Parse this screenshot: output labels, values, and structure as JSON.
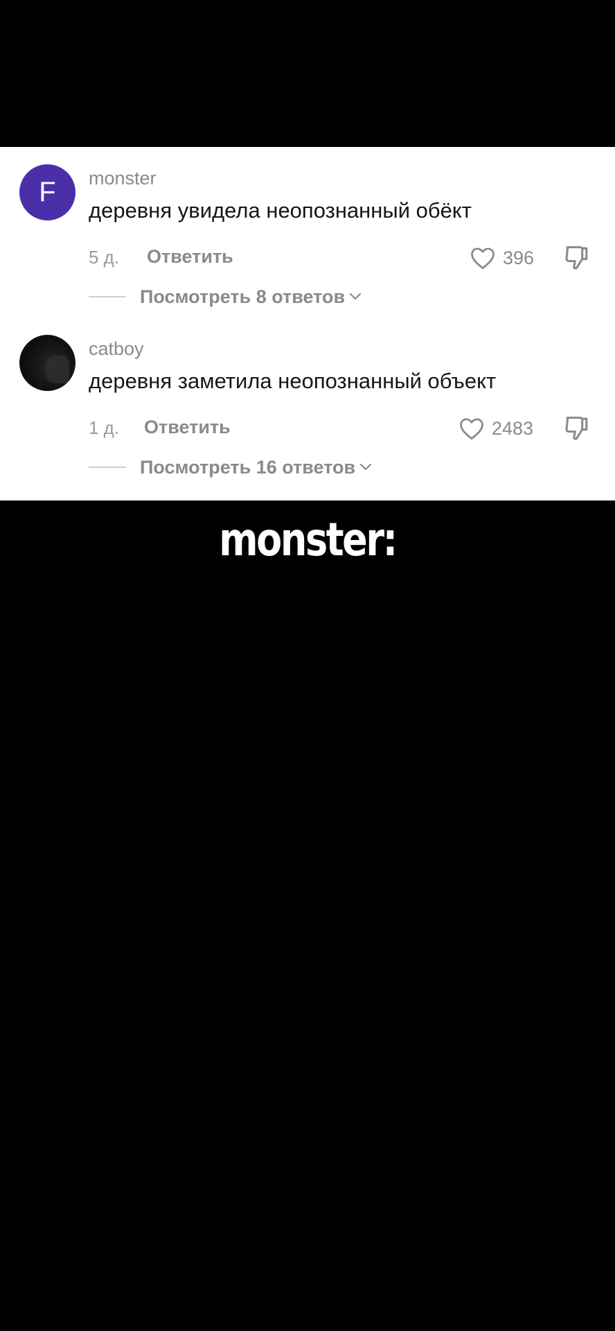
{
  "comments": [
    {
      "username": "monster",
      "avatar_letter": "F",
      "avatar_color": "#4b2fa8",
      "text": "деревня увидела неопознанный обёкт",
      "age": "5 д.",
      "reply_label": "Ответить",
      "likes": "396",
      "view_replies": "Посмотреть 8 ответов"
    },
    {
      "username": "catboy",
      "avatar": "dark-photo",
      "text": "деревня заметила неопознанный объект",
      "age": "1 д.",
      "reply_label": "Ответить",
      "likes": "2483",
      "view_replies": "Посмотреть 16 ответов"
    }
  ],
  "caption": "monster:",
  "icons": {
    "like": "heart-icon",
    "dislike": "thumbs-down-icon",
    "expand": "chevron-down-icon"
  }
}
